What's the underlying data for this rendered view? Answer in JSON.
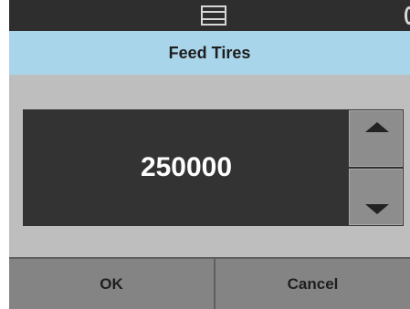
{
  "statusbar": {
    "icon": "window-icon"
  },
  "dialog": {
    "title": "Feed Tires"
  },
  "spinner": {
    "value": "250000",
    "up_icon": "triangle-up-icon",
    "down_icon": "triangle-down-icon"
  },
  "buttons": {
    "ok": "OK",
    "cancel": "Cancel"
  },
  "colors": {
    "status_bar": "#2e2e2e",
    "title_bar": "#a9d5ea",
    "background": "#bebebe",
    "value_panel": "#333333",
    "spin_buttons": "#8d8d8d",
    "action_buttons": "#848484"
  }
}
